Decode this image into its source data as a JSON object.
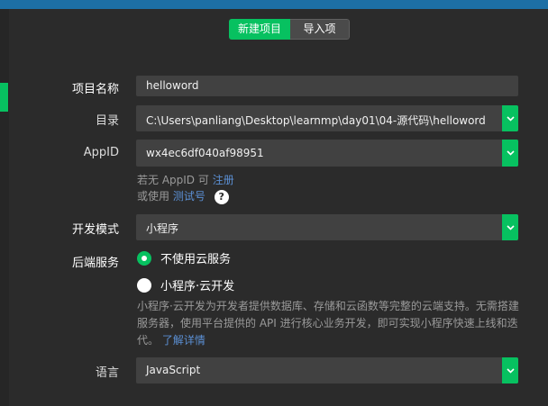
{
  "tabs": {
    "new_project": "新建项目",
    "import_project": "导入项目"
  },
  "form": {
    "name": {
      "label": "项目名称",
      "value": "helloword"
    },
    "directory": {
      "label": "目录",
      "value": "C:\\Users\\panliang\\Desktop\\learnmp\\day01\\04-源代码\\helloword"
    },
    "appid": {
      "label": "AppID",
      "value": "wx4ec6df040af98951",
      "hint_prefix": "若无 AppID 可",
      "hint_link": "注册",
      "hint2_prefix": "或使用",
      "hint2_link": "测试号",
      "help_symbol": "?"
    },
    "dev_mode": {
      "label": "开发模式",
      "value": "小程序"
    },
    "backend": {
      "label": "后端服务",
      "option1": "不使用云服务",
      "option2": "小程序·云开发",
      "description": "小程序·云开发为开发者提供数据库、存储和云函数等完整的云端支持。无需搭建服务器，使用平台提供的 API 进行核心业务开发，即可实现小程序快速上线和迭代。",
      "learn_more": "了解详情"
    },
    "language": {
      "label": "语言",
      "value": "JavaScript"
    }
  },
  "colors": {
    "accent": "#07c160",
    "link": "#5b8fd3",
    "topbar": "#1d6fa5",
    "background": "#2b2b2b",
    "field": "#414141"
  }
}
